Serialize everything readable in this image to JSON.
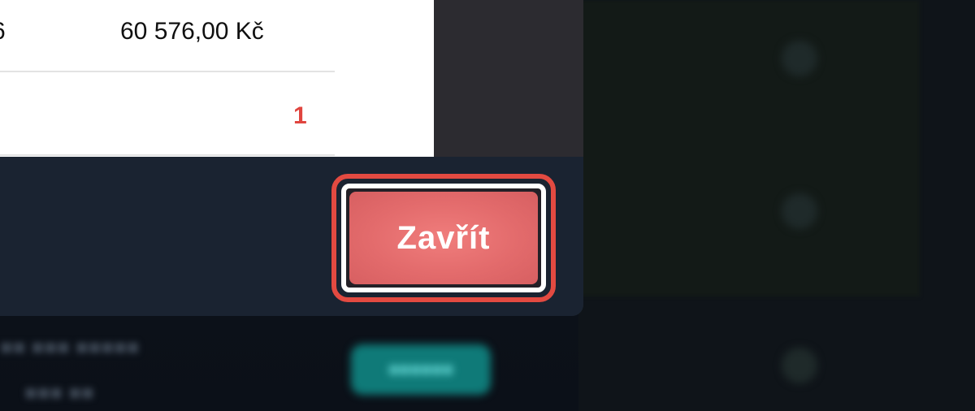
{
  "colors": {
    "accent": "#e36b6c",
    "highlight_border": "#e34a41",
    "count_red": "#e0453f",
    "modal_footer": "#1a2331"
  },
  "modal": {
    "table": {
      "row1": {
        "quantity_partial": "6",
        "amount": "60 576,00 Kč"
      },
      "row2": {
        "count": "1"
      }
    },
    "footer": {
      "close_label": "Zavřít"
    }
  }
}
